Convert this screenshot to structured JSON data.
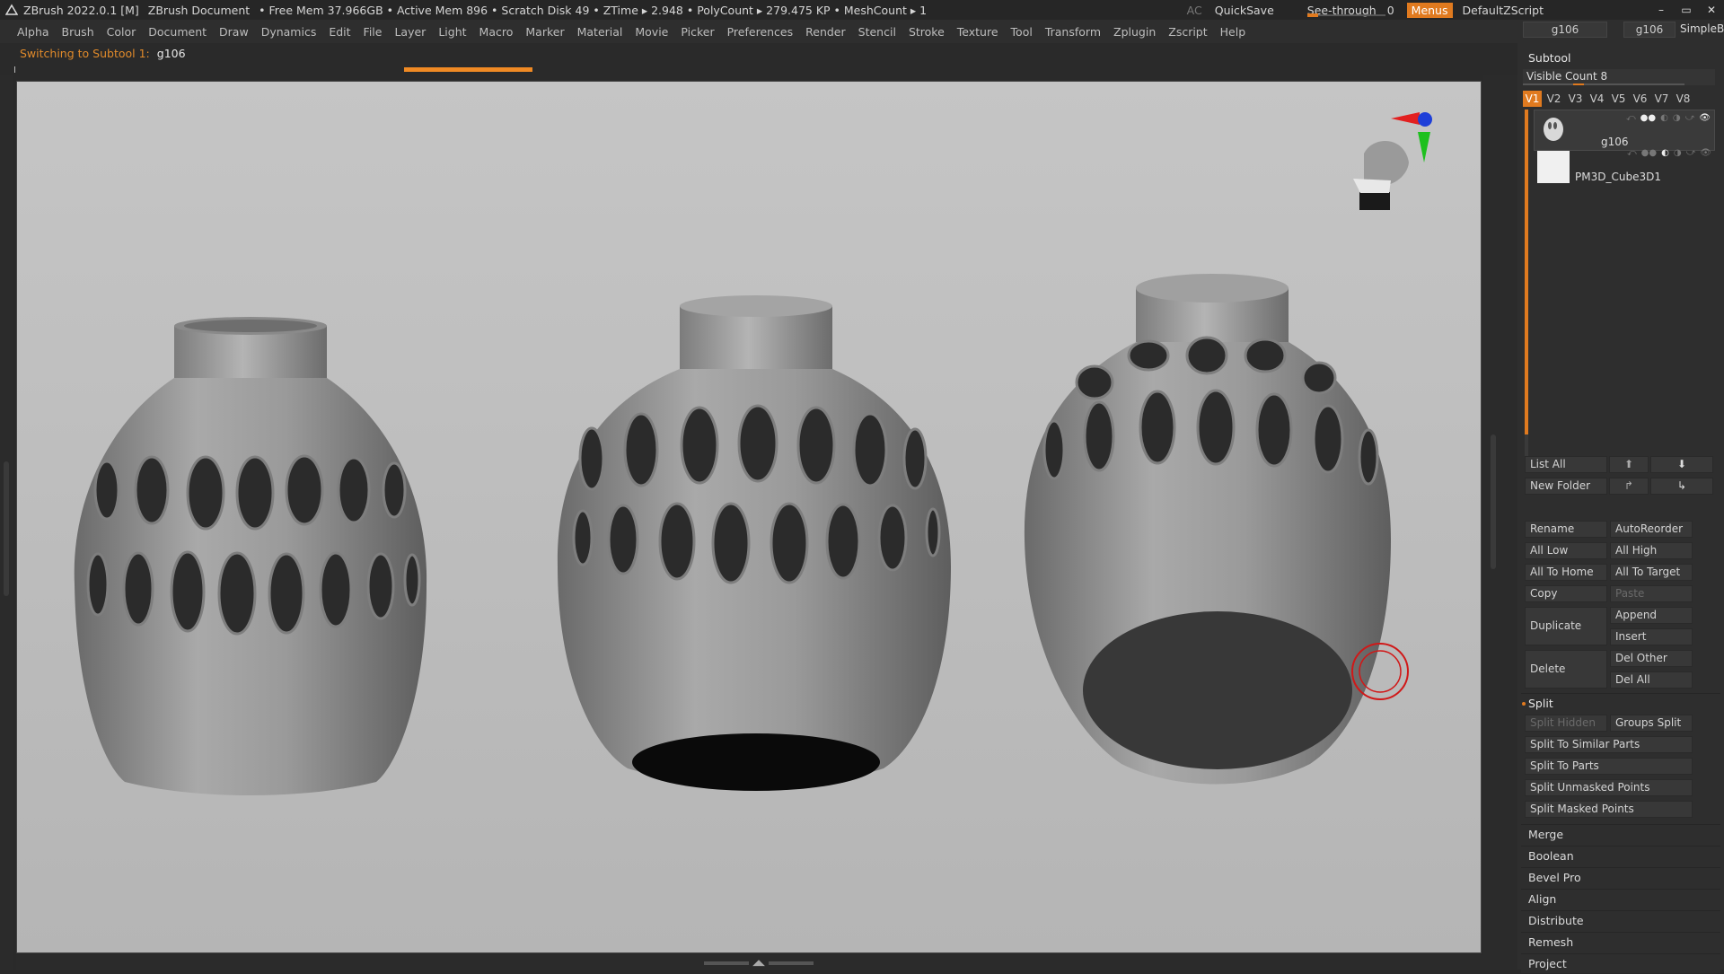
{
  "titlebar": {
    "app": "ZBrush 2022.0.1 [M]",
    "document": "ZBrush Document",
    "stats": "• Free Mem 37.966GB • Active Mem 896 • Scratch Disk 49 • ZTime ▸ 2.948 • PolyCount ▸ 279.475 KP • MeshCount ▸ 1",
    "ac": "AC",
    "quicksave": "QuickSave",
    "seethrough_label": "See-through",
    "seethrough_value": "0",
    "menus": "Menus",
    "script": "DefaultZScript",
    "win_min": "–",
    "win_max": "▭",
    "win_close": "✕"
  },
  "menubar": [
    "Alpha",
    "Brush",
    "Color",
    "Document",
    "Draw",
    "Dynamics",
    "Edit",
    "File",
    "Layer",
    "Light",
    "Macro",
    "Marker",
    "Material",
    "Movie",
    "Picker",
    "Preferences",
    "Render",
    "Stencil",
    "Stroke",
    "Texture",
    "Tool",
    "Transform",
    "Zplugin",
    "Zscript",
    "Help"
  ],
  "status": {
    "label": "Switching to Subtool 1:",
    "value": "g106",
    "progress": 0.12
  },
  "right_top": {
    "tool1": "g106",
    "tool2": "g106",
    "simpleb": "SimpleB"
  },
  "subtool": {
    "header": "Subtool",
    "visible_count": "Visible Count 8",
    "tabs": [
      "V1",
      "V2",
      "V3",
      "V4",
      "V5",
      "V6",
      "V7",
      "V8"
    ],
    "active_tab": "V1",
    "items": [
      {
        "name": "g106",
        "selected": true
      },
      {
        "name": "PM3D_Cube3D1",
        "selected": false
      }
    ],
    "buttons": {
      "list_all": "List All",
      "new_folder": "New Folder",
      "rename": "Rename",
      "autoreorder": "AutoReorder",
      "all_low": "All Low",
      "all_high": "All High",
      "all_to_home": "All To Home",
      "all_to_target": "All To Target",
      "copy": "Copy",
      "paste": "Paste",
      "duplicate": "Duplicate",
      "append": "Append",
      "insert": "Insert",
      "delete": "Delete",
      "del_other": "Del Other",
      "del_all": "Del All"
    },
    "split": {
      "title": "Split",
      "split_hidden": "Split Hidden",
      "groups_split": "Groups Split",
      "similar": "Split To Similar Parts",
      "parts": "Split To Parts",
      "unmasked": "Split Unmasked Points",
      "masked": "Split Masked Points"
    },
    "sections": [
      "Merge",
      "Boolean",
      "Bevel Pro",
      "Align",
      "Distribute",
      "Remesh",
      "Project"
    ]
  },
  "colors": {
    "accent": "#e07a1f",
    "panel": "#2e2e2e",
    "viewport": "#c0c0c0"
  }
}
